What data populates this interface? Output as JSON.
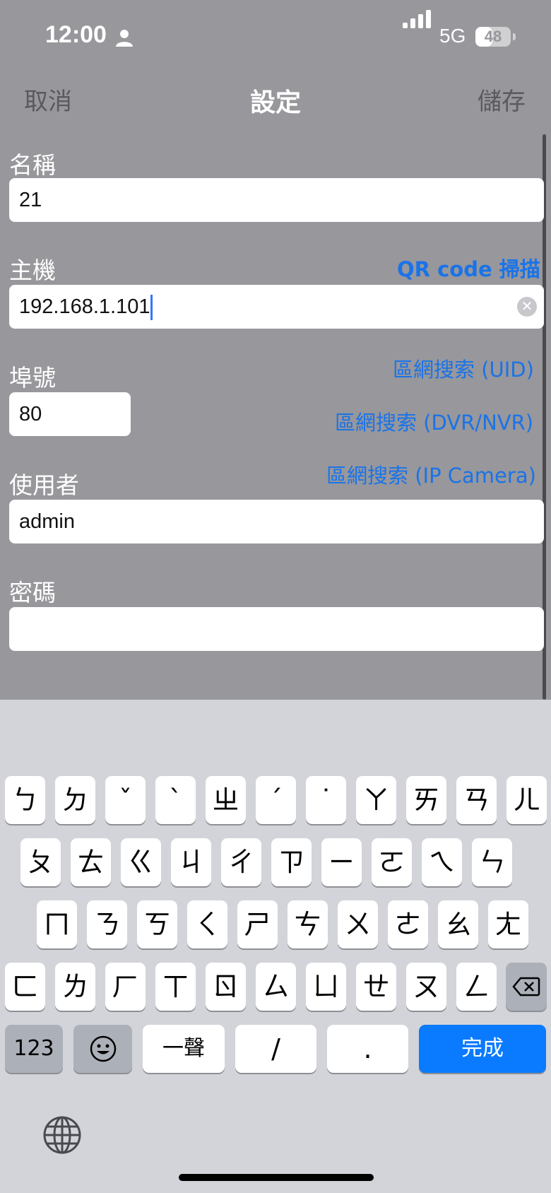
{
  "status_bar": {
    "time": "12:00",
    "network": "5G",
    "battery": "48",
    "battery_level": 0.48
  },
  "nav": {
    "cancel": "取消",
    "title": "設定",
    "save": "儲存"
  },
  "form": {
    "name_label": "名稱",
    "name_value": "21",
    "host_label": "主機",
    "host_value": "192.168.1.101",
    "qr_scan": "QR code 掃描",
    "port_label": "埠號",
    "port_value": "80",
    "lan_search_uid": "區網搜索 (UID)",
    "lan_search_dvr": "區網搜索 (DVR/NVR)",
    "lan_search_ipcam": "區網搜索 (IP Camera)",
    "user_label": "使用者",
    "user_value": "admin",
    "password_label": "密碼",
    "password_value": ""
  },
  "keyboard": {
    "rows": [
      [
        "ㄅ",
        "ㄉ",
        "ˇ",
        "ˋ",
        "ㄓ",
        "ˊ",
        "˙",
        "ㄚ",
        "ㄞ",
        "ㄢ",
        "ㄦ"
      ],
      [
        "ㄆ",
        "ㄊ",
        "ㄍ",
        "ㄐ",
        "ㄔ",
        "ㄗ",
        "ㄧ",
        "ㄛ",
        "ㄟ",
        "ㄣ"
      ],
      [
        "ㄇ",
        "ㄋ",
        "ㄎ",
        "ㄑ",
        "ㄕ",
        "ㄘ",
        "ㄨ",
        "ㄜ",
        "ㄠ",
        "ㄤ"
      ],
      [
        "ㄈ",
        "ㄌ",
        "ㄏ",
        "ㄒ",
        "ㄖ",
        "ㄙ",
        "ㄩ",
        "ㄝ",
        "ㄡ",
        "ㄥ"
      ]
    ],
    "numbers_key": "123",
    "first_tone_key": "一聲",
    "slash_key": "/",
    "dot_key": ".",
    "done_key": "完成",
    "emoji_icon": "emoji-icon",
    "backspace_icon": "backspace-icon",
    "globe_icon": "globe-icon"
  },
  "colors": {
    "link": "#1a73e8",
    "done_key": "#0a7aff",
    "overlay": "#97979c",
    "keyboard_bg": "#d2d4da"
  }
}
